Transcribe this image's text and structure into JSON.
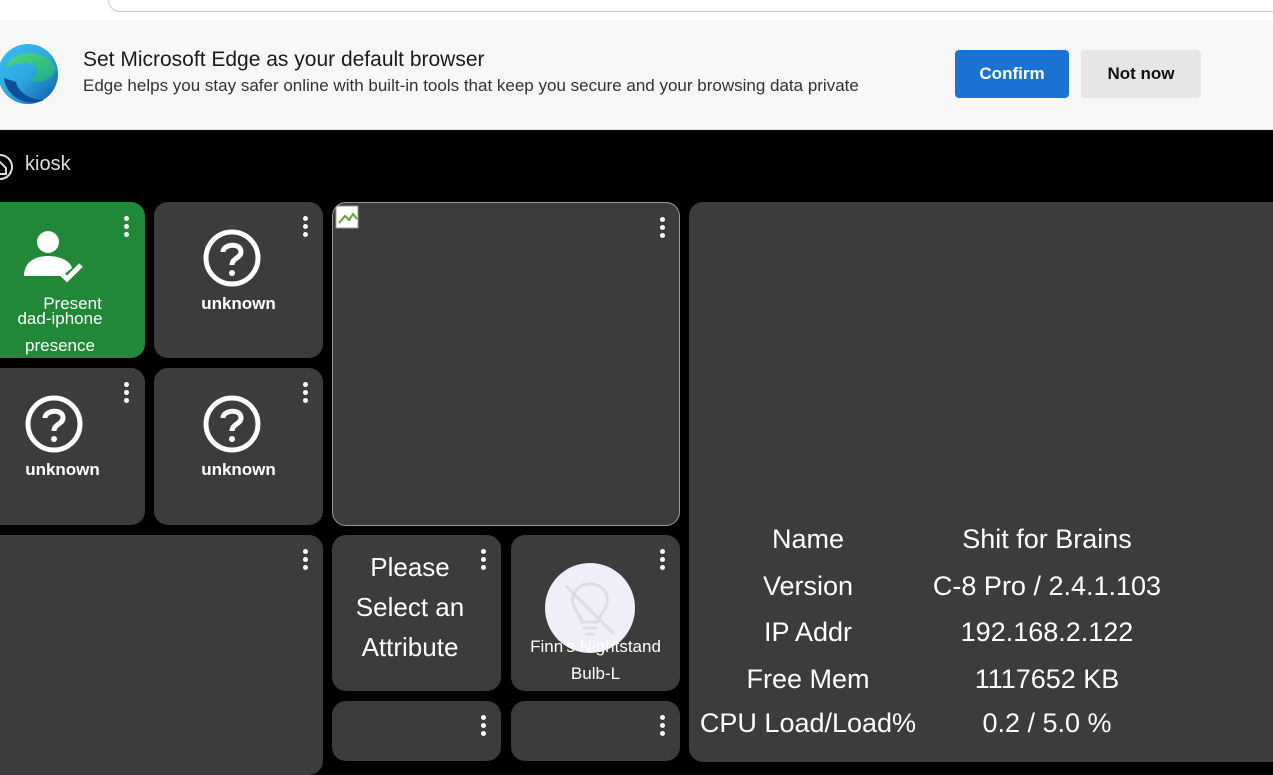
{
  "banner": {
    "title": "Set Microsoft Edge as your default browser",
    "description": "Edge helps you stay safer online with built-in tools that keep you secure and your browsing data private",
    "confirm_label": "Confirm",
    "not_now_label": "Not now"
  },
  "dashboard": {
    "title": "kiosk",
    "tiles": {
      "presence": {
        "status": "Present",
        "name": "dad-iphone presence",
        "color": "#218838"
      },
      "unknown_1": {
        "label": "unknown"
      },
      "unknown_2": {
        "label": "unknown"
      },
      "unknown_3": {
        "label": "unknown"
      },
      "attribute": {
        "label": "Please Select an Attribute"
      },
      "bulb": {
        "label": "Finn's Nightstand Bulb-L"
      }
    },
    "hub_info": {
      "rows": [
        {
          "label": "Name",
          "value": "Shit for Brains"
        },
        {
          "label": "Version",
          "value": "C-8 Pro / 2.4.1.103"
        },
        {
          "label": "IP Addr",
          "value": "192.168.2.122"
        },
        {
          "label": "Free Mem",
          "value": "1117652 KB"
        },
        {
          "label": "CPU Load/Load%",
          "value": "0.2 / 5.0 %"
        }
      ]
    }
  },
  "colors": {
    "tile_bg": "#3c3c3c",
    "confirm_bg": "#1a73d3",
    "page_bg": "#000000"
  },
  "icons": [
    "edge-logo-icon",
    "home-icon",
    "person-check-icon",
    "question-circle-icon",
    "lightbulb-off-icon",
    "more-vertical-icon",
    "broken-image-icon"
  ]
}
